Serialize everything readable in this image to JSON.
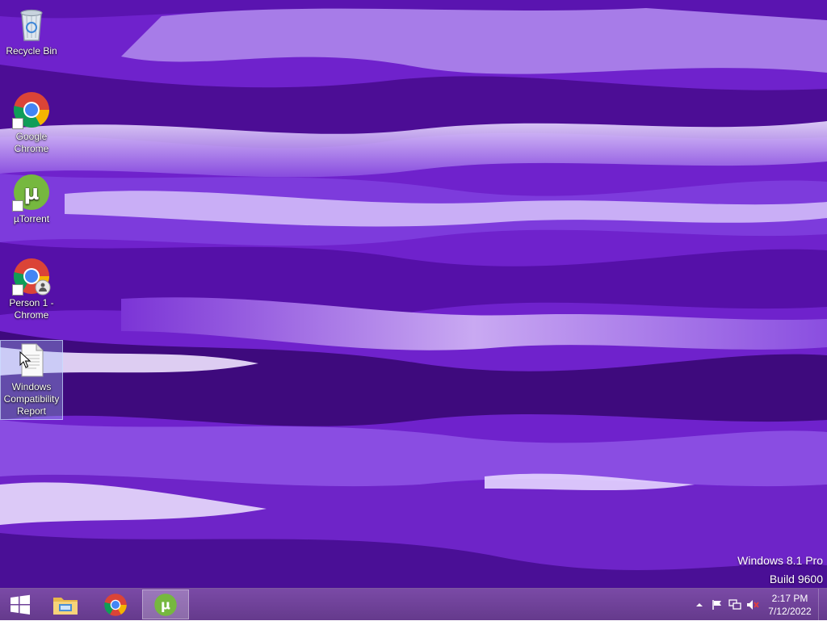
{
  "desktop_icons": [
    {
      "label": "Recycle Bin",
      "icon": "recycle-bin-icon",
      "selected": false
    },
    {
      "label": "Google Chrome",
      "icon": "chrome-icon",
      "shortcut": true,
      "selected": false
    },
    {
      "label": "µTorrent",
      "icon": "utorrent-icon",
      "shortcut": true,
      "selected": false
    },
    {
      "label": "Person 1 - Chrome",
      "icon": "chrome-person-icon",
      "shortcut": true,
      "selected": false
    },
    {
      "label": "Windows Compatibility Report",
      "icon": "document-icon",
      "selected": true
    }
  ],
  "watermark": {
    "line1": "Windows 8.1 Pro",
    "line2": "Build 9600"
  },
  "taskbar": {
    "start": {
      "icon": "windows-logo-icon"
    },
    "pinned": [
      {
        "name": "File Explorer",
        "icon": "folder-icon",
        "active": false
      },
      {
        "name": "Google Chrome",
        "icon": "chrome-icon",
        "active": false
      },
      {
        "name": "µTorrent",
        "icon": "utorrent-icon",
        "active": true
      }
    ],
    "tray": {
      "icons": [
        "chevron-up-icon",
        "flag-icon",
        "network-icon",
        "volume-muted-icon"
      ],
      "time": "2:17 PM",
      "date": "7/12/2022"
    }
  },
  "colors": {
    "wallpaper_base": "#6a1fc8",
    "taskbar": "#6f4399",
    "chrome_red": "#db4437",
    "chrome_green": "#0f9d58",
    "chrome_yellow": "#f4b400",
    "chrome_blue": "#4285f4",
    "utorrent_green": "#76b83f"
  }
}
